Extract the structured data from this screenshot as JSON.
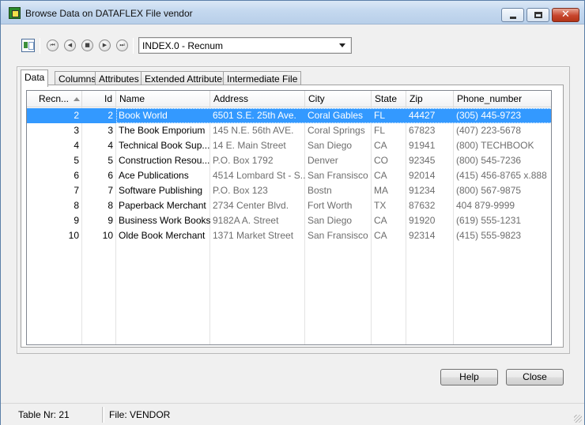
{
  "window": {
    "title": "Browse Data on DATAFLEX File vendor",
    "close_glyph": "✕"
  },
  "toolbar": {
    "index_value": "INDEX.0 - Recnum",
    "nav": {
      "first": "⏮",
      "prev": "◀",
      "current": "■",
      "next": "▶",
      "last": "⏭"
    }
  },
  "tabs": [
    {
      "label": "Data",
      "active": true
    },
    {
      "label": "Columns",
      "active": false
    },
    {
      "label": "Attributes",
      "active": false
    },
    {
      "label": "Extended Attributes",
      "active": false
    },
    {
      "label": "Intermediate File",
      "active": false
    }
  ],
  "grid": {
    "columns": [
      "Recn...",
      "Id",
      "Name",
      "Address",
      "City",
      "State",
      "Zip",
      "Phone_number"
    ],
    "selected_row_index": 0,
    "rows": [
      [
        "2",
        "2",
        "Book World",
        "6501 S.E. 25th Ave.",
        "Coral Gables",
        "FL",
        "44427",
        "(305) 445-9723"
      ],
      [
        "3",
        "3",
        "The Book Emporium",
        "145 N.E. 56th AVE.",
        "Coral Springs",
        "FL",
        "67823",
        "(407) 223-5678"
      ],
      [
        "4",
        "4",
        "Technical Book Sup...",
        "14 E. Main Street",
        "San Diego",
        "CA",
        "91941",
        "(800) TECHBOOK"
      ],
      [
        "5",
        "5",
        "Construction Resou...",
        "P.O. Box 1792",
        "Denver",
        "CO",
        "92345",
        "(800) 545-7236"
      ],
      [
        "6",
        "6",
        "Ace Publications",
        "4514 Lombard St - S...",
        "San Fransisco",
        "CA",
        "92014",
        "(415) 456-8765 x.888"
      ],
      [
        "7",
        "7",
        "Software Publishing",
        "P.O. Box 123",
        "Bostn",
        "MA",
        "91234",
        "(800) 567-9875"
      ],
      [
        "8",
        "8",
        "Paperback Merchant",
        "2734 Center Blvd.",
        "Fort Worth",
        "TX",
        "87632",
        "404 879-9999"
      ],
      [
        "9",
        "9",
        "Business Work Books",
        "9182A A. Street",
        "San Diego",
        "CA",
        "91920",
        "(619) 555-1231"
      ],
      [
        "10",
        "10",
        "Olde Book Merchant",
        "1371 Market Street",
        "San Fransisco",
        "CA",
        "92314",
        "(415) 555-9823"
      ]
    ]
  },
  "buttons": {
    "help": "Help",
    "close": "Close"
  },
  "statusbar": {
    "table_nr": "Table Nr: 21",
    "file": "File: VENDOR"
  }
}
